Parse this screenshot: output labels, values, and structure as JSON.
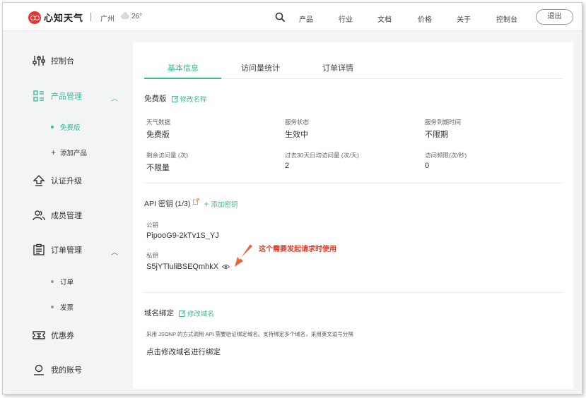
{
  "header": {
    "logo_text": "心知天气",
    "city": "广州",
    "temperature": "26°",
    "weather_icon": "cloud-icon",
    "nav": [
      "产品",
      "行业",
      "文档",
      "价格",
      "关于",
      "控制台"
    ],
    "logout_label": "退出"
  },
  "sidebar": {
    "items": [
      {
        "label": "控制台",
        "icon": "sliders-icon"
      },
      {
        "label": "产品管理",
        "icon": "grid-list-icon"
      },
      {
        "label": "认证升级",
        "icon": "upgrade-icon"
      },
      {
        "label": "成员管理",
        "icon": "members-icon"
      },
      {
        "label": "订单管理",
        "icon": "order-icon"
      },
      {
        "label": "优惠券",
        "icon": "coupon-icon"
      },
      {
        "label": "我的账号",
        "icon": "user-icon"
      }
    ],
    "product_sub": [
      "免费版",
      "添加产品"
    ],
    "order_sub": [
      "订单",
      "发票"
    ]
  },
  "tabs": [
    "基本信息",
    "访问量统计",
    "订单详情"
  ],
  "plan": {
    "title": "免费版",
    "edit_label": "修改名称",
    "fields": [
      {
        "label": "天气数据",
        "value": "免费版"
      },
      {
        "label": "服务状态",
        "value": "生效中"
      },
      {
        "label": "服务到期时间",
        "value": "不限期"
      },
      {
        "label": "剩余访问量 (次)",
        "value": "不限量"
      },
      {
        "label": "过去30天日均访问量 (次/天)",
        "value": "2"
      },
      {
        "label": "访问频限(次/秒)",
        "value": "0"
      }
    ]
  },
  "api": {
    "title": "API 密钥 (1/3)",
    "add_label": "添加密钥",
    "public_label": "公钥",
    "public_key": "PipooG9-2kTv1S_YJ",
    "private_label": "私钥",
    "private_key": "S5jYTluliBSEQmhkX",
    "annotation": "这个需要发起请求时使用"
  },
  "domain": {
    "title": "域名绑定",
    "edit_label": "修改域名",
    "note": "采用 JSONP 的方式调用 API 需要验证绑定域名。支持绑定多个域名，采用英文逗号分隔",
    "action": "点击修改域名进行绑定"
  },
  "colors": {
    "accent": "#3fb98f",
    "brand": "#e8322e",
    "annotation": "#e63b24"
  }
}
